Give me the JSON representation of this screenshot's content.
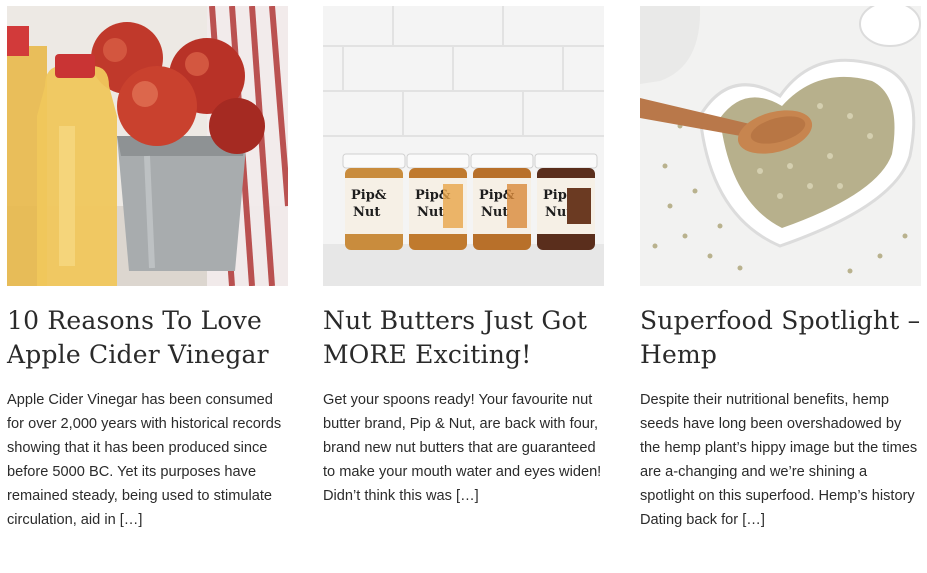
{
  "posts": [
    {
      "image_alt": "Bottles of apple cider vinegar beside a bucket of red apples",
      "title": "10 Reasons To Love Apple Cider Vinegar",
      "excerpt": "Apple Cider Vinegar has been consumed for over 2,000 years with historical records showing that it has been produced since before 5000 BC. Yet its purposes have remained steady, being used to stimulate circulation, aid in […]"
    },
    {
      "image_alt": "Four jars of Pip & Nut nut butter",
      "title": "Nut Butters Just Got MORE Exciting!",
      "excerpt": "Get your spoons ready! Your favourite nut butter brand, Pip & Nut, are back with four, brand new nut butters that are guaranteed to make your mouth water and eyes widen! Didn’t think this was […]",
      "jar_brand_line1": "Pip&",
      "jar_brand_line2": "Nut"
    },
    {
      "image_alt": "Hemp seeds in a white heart-shaped dish with a wooden spoon",
      "title": "Superfood Spotlight – Hemp",
      "excerpt": "Despite their nutritional benefits, hemp seeds have long been overshadowed by the hemp plant’s hippy image but the times are a-changing and we’re shining a spotlight on this superfood.   Hemp’s history Dating back for […]"
    }
  ]
}
